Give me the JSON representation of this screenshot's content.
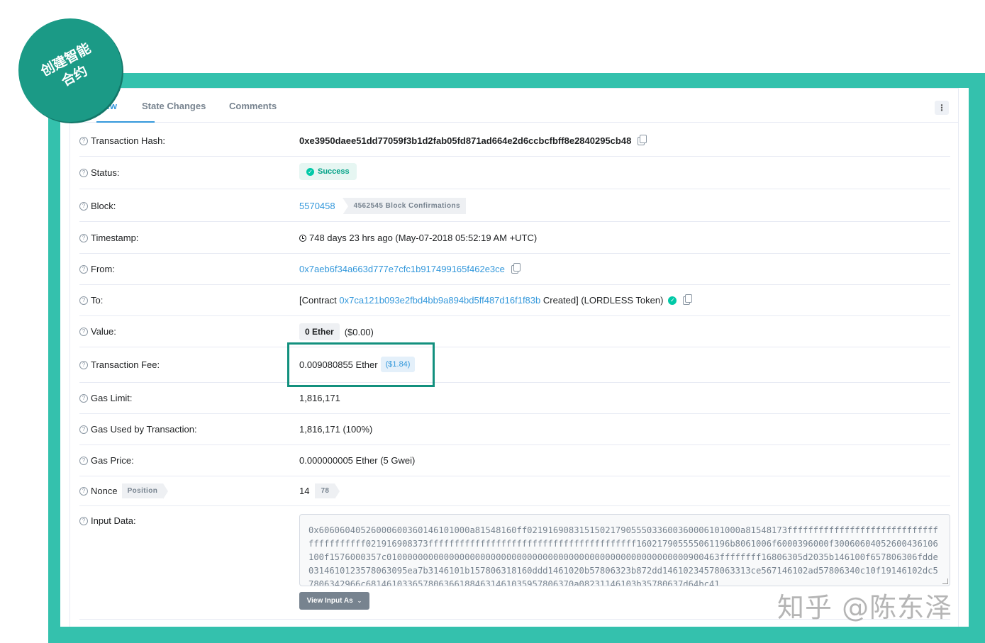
{
  "badge": {
    "line1": "创建智能",
    "line2": "合约"
  },
  "tabs": [
    {
      "label": "Overview",
      "visible_label": "iew",
      "active": true
    },
    {
      "label": "State Changes",
      "active": false
    },
    {
      "label": "Comments",
      "active": false
    }
  ],
  "more_icon": "more-vertical-icon",
  "fields": {
    "tx_hash": {
      "label": "Transaction Hash:",
      "value": "0xe3950daee51dd77059f3b1d2fab05fd871ad664e2d6ccbcfbff8e2840295cb48"
    },
    "status": {
      "label": "Status:",
      "value": "Success"
    },
    "block": {
      "label": "Block:",
      "value": "5570458",
      "confirmations": "4562545 Block Confirmations"
    },
    "timestamp": {
      "label": "Timestamp:",
      "value": "748 days 23 hrs ago (May-07-2018 05:52:19 AM +UTC)"
    },
    "from": {
      "label": "From:",
      "value": "0x7aeb6f34a663d777e7cfc1b917499165f462e3ce"
    },
    "to": {
      "label": "To:",
      "prefix": "[Contract",
      "address": "0x7ca121b093e2fbd4bb9a894bd5ff487d16f1f83b",
      "suffix": "Created] (LORDLESS Token)"
    },
    "value": {
      "label": "Value:",
      "ether": "0 Ether",
      "usd": "($0.00)"
    },
    "fee": {
      "label": "Transaction Fee:",
      "ether": "0.009080855 Ether",
      "usd": "($1.84)"
    },
    "gas_limit": {
      "label": "Gas Limit:",
      "value": "1,816,171"
    },
    "gas_used": {
      "label": "Gas Used by Transaction:",
      "value": "1,816,171 (100%)"
    },
    "gas_price": {
      "label": "Gas Price:",
      "value": "0.000000005 Ether (5 Gwei)"
    },
    "nonce": {
      "label": "Nonce",
      "tag": "Position",
      "value": "14",
      "position": "78"
    },
    "input_data": {
      "label": "Input Data:",
      "value": "0x60606040526000600360146101000a81548160ff02191690831515021790555033600360006101000a81548173ffffffffffffffffffffffffffffffffffffffff021916908373ffffffffffffffffffffffffffffffffffffffff160217905555061196b8061006f6000396000f300606040526004361061​00f1576000357c0100000000000000000000000000000000000000000000000000000000900463ffffffff16806305d2035b146100f657806306fdde03146101235780630​95ea7b3146101b157806318160ddd1461020b57806323b872dd146102345780​63313ce567146102ad57806340c10f19146102dc57806342966c681461033657806366188463146103595780637​0a08231146103b35780637​d64bc41",
      "button": "View Input As"
    }
  },
  "watermark": "知乎 @陈东泽"
}
